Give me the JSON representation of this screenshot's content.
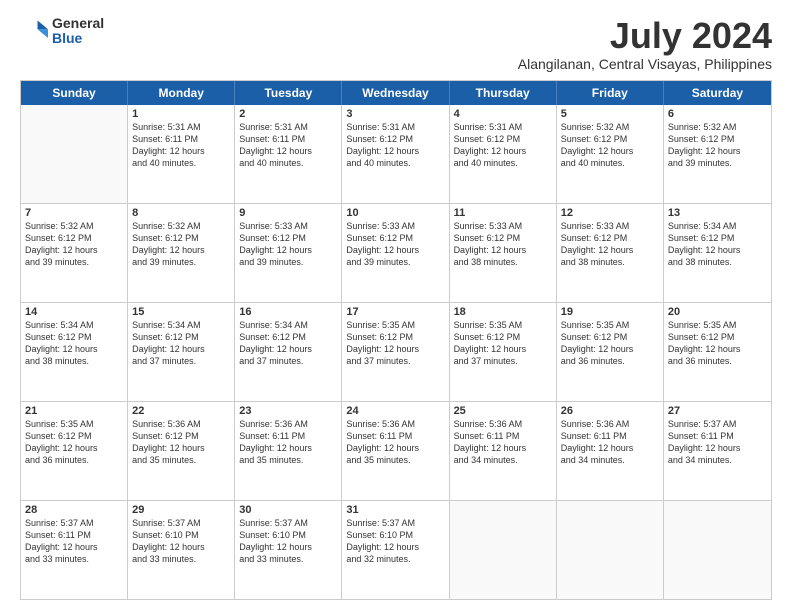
{
  "logo": {
    "general": "General",
    "blue": "Blue"
  },
  "title": "July 2024",
  "subtitle": "Alangilanan, Central Visayas, Philippines",
  "header_days": [
    "Sunday",
    "Monday",
    "Tuesday",
    "Wednesday",
    "Thursday",
    "Friday",
    "Saturday"
  ],
  "weeks": [
    [
      {
        "day": "",
        "info": ""
      },
      {
        "day": "1",
        "info": "Sunrise: 5:31 AM\nSunset: 6:11 PM\nDaylight: 12 hours\nand 40 minutes."
      },
      {
        "day": "2",
        "info": "Sunrise: 5:31 AM\nSunset: 6:11 PM\nDaylight: 12 hours\nand 40 minutes."
      },
      {
        "day": "3",
        "info": "Sunrise: 5:31 AM\nSunset: 6:12 PM\nDaylight: 12 hours\nand 40 minutes."
      },
      {
        "day": "4",
        "info": "Sunrise: 5:31 AM\nSunset: 6:12 PM\nDaylight: 12 hours\nand 40 minutes."
      },
      {
        "day": "5",
        "info": "Sunrise: 5:32 AM\nSunset: 6:12 PM\nDaylight: 12 hours\nand 40 minutes."
      },
      {
        "day": "6",
        "info": "Sunrise: 5:32 AM\nSunset: 6:12 PM\nDaylight: 12 hours\nand 39 minutes."
      }
    ],
    [
      {
        "day": "7",
        "info": "Sunrise: 5:32 AM\nSunset: 6:12 PM\nDaylight: 12 hours\nand 39 minutes."
      },
      {
        "day": "8",
        "info": "Sunrise: 5:32 AM\nSunset: 6:12 PM\nDaylight: 12 hours\nand 39 minutes."
      },
      {
        "day": "9",
        "info": "Sunrise: 5:33 AM\nSunset: 6:12 PM\nDaylight: 12 hours\nand 39 minutes."
      },
      {
        "day": "10",
        "info": "Sunrise: 5:33 AM\nSunset: 6:12 PM\nDaylight: 12 hours\nand 39 minutes."
      },
      {
        "day": "11",
        "info": "Sunrise: 5:33 AM\nSunset: 6:12 PM\nDaylight: 12 hours\nand 38 minutes."
      },
      {
        "day": "12",
        "info": "Sunrise: 5:33 AM\nSunset: 6:12 PM\nDaylight: 12 hours\nand 38 minutes."
      },
      {
        "day": "13",
        "info": "Sunrise: 5:34 AM\nSunset: 6:12 PM\nDaylight: 12 hours\nand 38 minutes."
      }
    ],
    [
      {
        "day": "14",
        "info": "Sunrise: 5:34 AM\nSunset: 6:12 PM\nDaylight: 12 hours\nand 38 minutes."
      },
      {
        "day": "15",
        "info": "Sunrise: 5:34 AM\nSunset: 6:12 PM\nDaylight: 12 hours\nand 37 minutes."
      },
      {
        "day": "16",
        "info": "Sunrise: 5:34 AM\nSunset: 6:12 PM\nDaylight: 12 hours\nand 37 minutes."
      },
      {
        "day": "17",
        "info": "Sunrise: 5:35 AM\nSunset: 6:12 PM\nDaylight: 12 hours\nand 37 minutes."
      },
      {
        "day": "18",
        "info": "Sunrise: 5:35 AM\nSunset: 6:12 PM\nDaylight: 12 hours\nand 37 minutes."
      },
      {
        "day": "19",
        "info": "Sunrise: 5:35 AM\nSunset: 6:12 PM\nDaylight: 12 hours\nand 36 minutes."
      },
      {
        "day": "20",
        "info": "Sunrise: 5:35 AM\nSunset: 6:12 PM\nDaylight: 12 hours\nand 36 minutes."
      }
    ],
    [
      {
        "day": "21",
        "info": "Sunrise: 5:35 AM\nSunset: 6:12 PM\nDaylight: 12 hours\nand 36 minutes."
      },
      {
        "day": "22",
        "info": "Sunrise: 5:36 AM\nSunset: 6:12 PM\nDaylight: 12 hours\nand 35 minutes."
      },
      {
        "day": "23",
        "info": "Sunrise: 5:36 AM\nSunset: 6:11 PM\nDaylight: 12 hours\nand 35 minutes."
      },
      {
        "day": "24",
        "info": "Sunrise: 5:36 AM\nSunset: 6:11 PM\nDaylight: 12 hours\nand 35 minutes."
      },
      {
        "day": "25",
        "info": "Sunrise: 5:36 AM\nSunset: 6:11 PM\nDaylight: 12 hours\nand 34 minutes."
      },
      {
        "day": "26",
        "info": "Sunrise: 5:36 AM\nSunset: 6:11 PM\nDaylight: 12 hours\nand 34 minutes."
      },
      {
        "day": "27",
        "info": "Sunrise: 5:37 AM\nSunset: 6:11 PM\nDaylight: 12 hours\nand 34 minutes."
      }
    ],
    [
      {
        "day": "28",
        "info": "Sunrise: 5:37 AM\nSunset: 6:11 PM\nDaylight: 12 hours\nand 33 minutes."
      },
      {
        "day": "29",
        "info": "Sunrise: 5:37 AM\nSunset: 6:10 PM\nDaylight: 12 hours\nand 33 minutes."
      },
      {
        "day": "30",
        "info": "Sunrise: 5:37 AM\nSunset: 6:10 PM\nDaylight: 12 hours\nand 33 minutes."
      },
      {
        "day": "31",
        "info": "Sunrise: 5:37 AM\nSunset: 6:10 PM\nDaylight: 12 hours\nand 32 minutes."
      },
      {
        "day": "",
        "info": ""
      },
      {
        "day": "",
        "info": ""
      },
      {
        "day": "",
        "info": ""
      }
    ]
  ]
}
